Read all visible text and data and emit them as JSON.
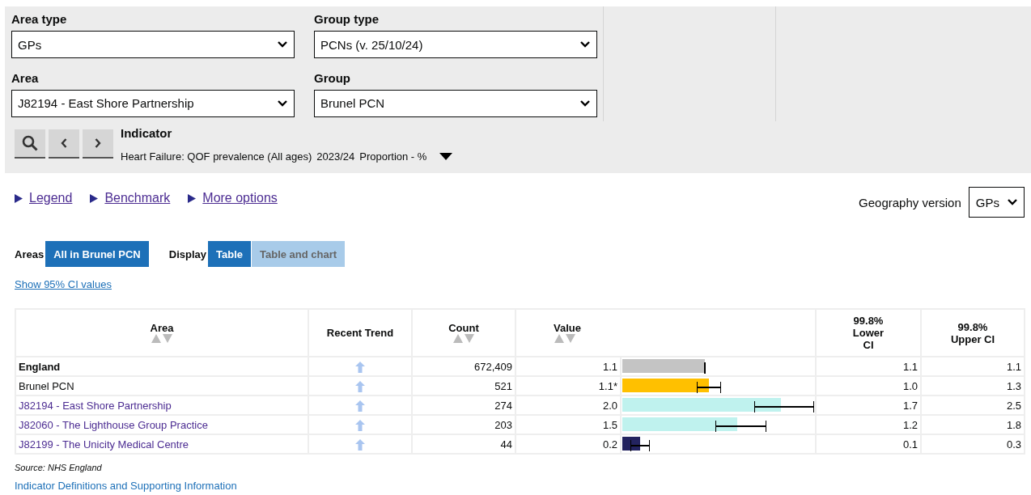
{
  "filters": [
    {
      "label": "Area type",
      "value": "GPs"
    },
    {
      "label": "Group type",
      "value": "PCNs (v. 25/10/24)"
    },
    {
      "label": "Area",
      "value": "J82194 - East Shore Partnership"
    },
    {
      "label": "Group",
      "value": "Brunel PCN"
    }
  ],
  "indicator": {
    "label": "Indicator",
    "name": "Heart Failure: QOF prevalence (All ages)",
    "period": "2023/24",
    "unit": "Proportion - %"
  },
  "links": [
    {
      "label": "Legend"
    },
    {
      "label": "Benchmark"
    },
    {
      "label": "More options"
    }
  ],
  "geography_version": {
    "label": "Geography version",
    "value": "GPs"
  },
  "toggles": [
    {
      "label": "Areas",
      "options": [
        {
          "label": "All in Brunel PCN",
          "selected": true
        }
      ]
    },
    {
      "label": "Display",
      "options": [
        {
          "label": "Table",
          "selected": true
        },
        {
          "label": "Table and chart",
          "selected": false
        }
      ]
    }
  ],
  "ci_link": "Show 95% CI values",
  "table": {
    "columns": [
      {
        "label": "Area",
        "sortable": true
      },
      {
        "label": "Recent Trend",
        "sortable": false
      },
      {
        "label": "Count",
        "sortable": true
      },
      {
        "label": "Value",
        "sortable": true
      },
      {
        "label": "99.8% Lower CI",
        "sortable": false
      },
      {
        "label": "99.8% Upper CI",
        "sortable": false
      }
    ],
    "rows": [
      {
        "kind": "national",
        "area": "England",
        "count": "672,409",
        "value": "1.1",
        "bar": {
          "level": 0.425,
          "color": "#c4c4c4"
        },
        "error_start": {
          "level": 0.425
        },
        "error_end": {
          "level": 0.425
        },
        "lower_ci": "1.1",
        "upper_ci": "1.1"
      },
      {
        "kind": "group",
        "area": "Brunel PCN",
        "count": "521",
        "value": "1.1*",
        "bar": {
          "level": 0.446,
          "color": "#ffc000"
        },
        "error_start": {
          "level": 0.388
        },
        "error_end": {
          "level": 0.504
        },
        "lower_ci": "1.0",
        "upper_ci": "1.3"
      },
      {
        "kind": "practice",
        "area": "J82194 - East Shore Partnership",
        "count": "274",
        "value": "2.0",
        "bar": {
          "level": 0.817,
          "color": "#bff2ee"
        },
        "error_start": {
          "level": 0.683
        },
        "error_end": {
          "level": 0.983
        },
        "lower_ci": "1.7",
        "upper_ci": "2.5"
      },
      {
        "kind": "practice",
        "area": "J82060 - The Lighthouse Group Practice",
        "count": "203",
        "value": "1.5",
        "bar": {
          "level": 0.592,
          "color": "#bff2ee"
        },
        "error_start": {
          "level": 0.483
        },
        "error_end": {
          "level": 0.738
        },
        "lower_ci": "1.2",
        "upper_ci": "1.8"
      },
      {
        "kind": "practice",
        "area": "J82199 - The Unicity Medical Centre",
        "count": "44",
        "value": "0.2",
        "bar": {
          "level": 0.092,
          "color": "#23235f"
        },
        "error_start": {
          "level": 0.046
        },
        "error_end": {
          "level": 0.138
        },
        "lower_ci": "0.1",
        "upper_ci": "0.3"
      }
    ]
  },
  "source": "Source: NHS England",
  "definitions_link": "Indicator Definitions and Supporting Information"
}
